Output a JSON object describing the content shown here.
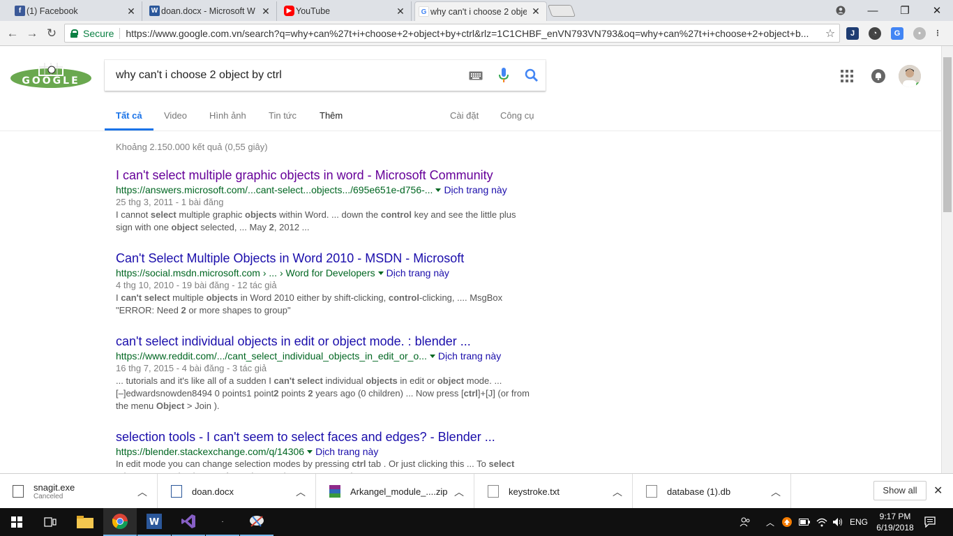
{
  "browser": {
    "tabs": [
      {
        "title": "(1) Facebook",
        "icon": "facebook-icon",
        "color": "#3b5998"
      },
      {
        "title": "doan.docx - Microsoft W",
        "icon": "word-icon",
        "color": "#2b579a"
      },
      {
        "title": "YouTube",
        "icon": "youtube-icon",
        "color": "#ff0000"
      },
      {
        "title": "why can't i choose 2 obje",
        "icon": "google-icon",
        "color": "#4285f4"
      }
    ],
    "secure_label": "Secure",
    "url": "https://www.google.com.vn/search?q=why+can%27t+i+choose+2+object+by+ctrl&rlz=1C1CHBF_enVN793VN793&oq=why+can%27t+i+choose+2+object+b..."
  },
  "search": {
    "query": "why can't i choose 2 object by ctrl",
    "logo_text": "GOOGLE"
  },
  "nav": {
    "tabs": [
      "Tất cả",
      "Video",
      "Hình ảnh",
      "Tin tức",
      "Thêm"
    ],
    "settings": "Cài đặt",
    "tools": "Công cụ"
  },
  "stats": "Khoảng 2.150.000 kết quả (0,55 giây)",
  "results": [
    {
      "title": "I can't select multiple graphic objects in word - Microsoft Community",
      "visited": true,
      "url": "https://answers.microsoft.com/...cant-select...objects.../695e651e-d756-...",
      "translate": "Dịch trang này",
      "date": "25 thg 3, 2011 - 1 bài đăng",
      "snippet_html": "I cannot <b>select</b> multiple graphic <b>objects</b> within Word. ... down the <b>control</b> key and see the little plus sign with one <b>object</b> selected, ... May <b>2</b>, 2012 ..."
    },
    {
      "title": "Can't Select Multiple Objects in Word 2010 - MSDN - Microsoft",
      "visited": false,
      "url": "https://social.msdn.microsoft.com › ... › Word for Developers",
      "translate": "Dịch trang này",
      "date": "4 thg 10, 2010 - 19 bài đăng - 12 tác giả",
      "snippet_html": "I <b>can't select</b> multiple <b>objects</b> in Word 2010 either by shift-clicking, <b>control</b>-clicking, .... MsgBox \"ERROR: Need <b>2</b> or more shapes to group\""
    },
    {
      "title": "can't select individual objects in edit or object mode. : blender ...",
      "visited": false,
      "url": "https://www.reddit.com/.../cant_select_individual_objects_in_edit_or_o...",
      "translate": "Dịch trang này",
      "date": "16 thg 7, 2015 - 4 bài đăng - 3 tác giả",
      "snippet_html": "... tutorials and it's like all of a sudden I <b>can't select</b> individual <b>objects</b> in edit or <b>object</b> mode. ... [–]edwardsnowden8494 0 points1 point<b>2</b> points <b>2</b> years ago (0 children) ... Now press [<b>ctrl</b>]+[J] (or from the menu <b>Object</b> &gt; Join )."
    },
    {
      "title": "selection tools - I can't seem to select faces and edges? - Blender ...",
      "visited": false,
      "url": "https://blender.stackexchange.com/q/14306",
      "translate": "Dịch trang này",
      "date": "",
      "snippet_html": "In edit mode you can change selection modes by pressing <b>ctrl</b> tab . Or just clicking this ... To <b>select</b> edges you need to be on <b>edge</b> select mode. To use more than ..."
    }
  ],
  "downloads": [
    {
      "name": "snagit.exe",
      "status": "Canceled",
      "icon": "exe-file-icon"
    },
    {
      "name": "doan.docx",
      "status": "",
      "icon": "word-file-icon"
    },
    {
      "name": "Arkangel_module_....zip",
      "status": "",
      "icon": "zip-file-icon"
    },
    {
      "name": "keystroke.txt",
      "status": "",
      "icon": "text-file-icon"
    },
    {
      "name": "database (1).db",
      "status": "",
      "icon": "db-file-icon"
    }
  ],
  "show_all": "Show all",
  "taskbar": {
    "lang": "ENG",
    "time": "9:17 PM",
    "date": "6/19/2018"
  }
}
